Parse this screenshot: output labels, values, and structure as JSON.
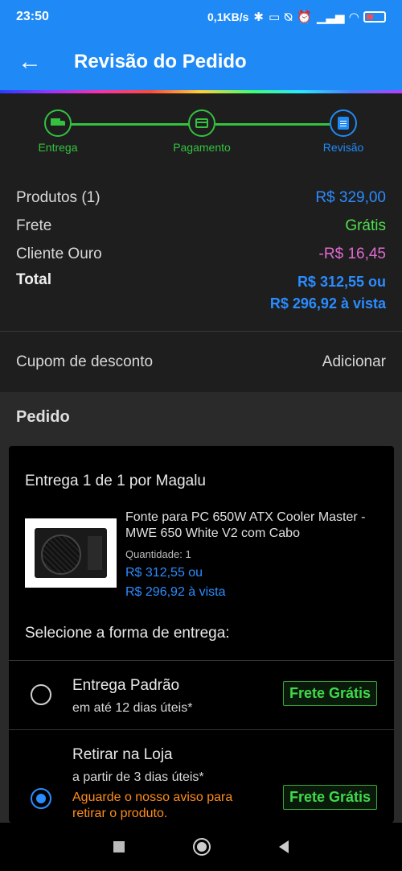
{
  "status_bar": {
    "time": "23:50",
    "network_speed": "0,1KB/s",
    "icons": [
      "bluetooth-icon",
      "vibrate-icon",
      "mute-icon",
      "alarm-icon",
      "signal-icon",
      "signal-icon-2",
      "wifi-icon",
      "battery-icon"
    ]
  },
  "app_bar": {
    "title": "Revisão do Pedido",
    "back_icon": "arrow-back-icon"
  },
  "stepper": {
    "steps": [
      {
        "label": "Entrega",
        "icon": "truck-icon",
        "state": "done"
      },
      {
        "label": "Pagamento",
        "icon": "card-icon",
        "state": "done"
      },
      {
        "label": "Revisão",
        "icon": "document-icon",
        "state": "current"
      }
    ]
  },
  "summary": {
    "products_label": "Produtos (1)",
    "products_value": "R$ 329,00",
    "shipping_label": "Frete",
    "shipping_value": "Grátis",
    "gold_label": "Cliente Ouro",
    "gold_value": "-R$ 16,45",
    "total_label": "Total",
    "total_value": "R$ 312,55 ou",
    "total_cash": "R$ 296,92 à vista"
  },
  "coupon": {
    "label": "Cupom de desconto",
    "action": "Adicionar"
  },
  "order": {
    "section_title": "Pedido",
    "card_title": "Entrega 1 de 1 por Magalu",
    "product": {
      "name": "Fonte para PC 650W ATX Cooler Master - MWE 650 White V2 com Cabo",
      "quantity_label": "Quantidade:",
      "quantity": "1",
      "price": "R$ 312,55 ou",
      "price_cash": "R$ 296,92 à vista"
    },
    "delivery_title": "Selecione a forma de entrega:",
    "options": [
      {
        "title": "Entrega Padrão",
        "subtitle": "em até 12 dias úteis*",
        "badge": "Frete Grátis",
        "selected": false
      },
      {
        "title": "Retirar na Loja",
        "subtitle": "a partir de 3 dias úteis*",
        "warning": "Aguarde o nosso aviso para retirar o produto.",
        "badge": "Frete Grátis",
        "selected": true
      }
    ]
  },
  "colors": {
    "brand_blue": "#1f8af6",
    "price_blue": "#2b8cff",
    "success_green": "#33c13f",
    "discount_pink": "#e06ad0",
    "warning_orange": "#ff8c1a"
  }
}
